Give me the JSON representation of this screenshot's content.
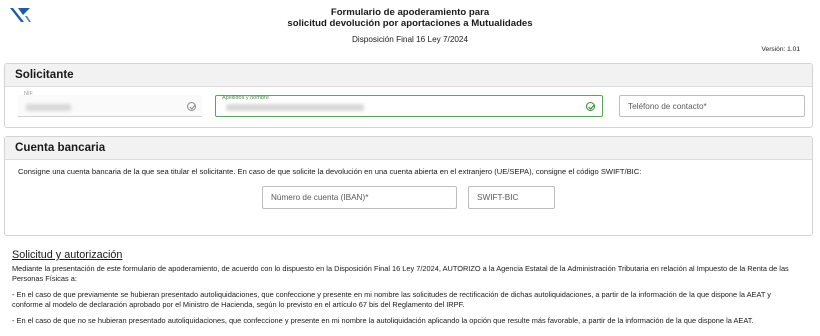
{
  "header": {
    "title_line1": "Formulario de apoderamiento para",
    "title_line2": "solicitud devolución por aportaciones a Mutualidades",
    "subtitle": "Disposición Final 16 Ley 7/2024",
    "version": "Versión: 1.01"
  },
  "solicitante": {
    "title": "Solicitante",
    "nif_label": "NIF",
    "apellidos_label": "Apellidos y nombre",
    "telefono_placeholder": "Teléfono de contacto*"
  },
  "cuenta": {
    "title": "Cuenta bancaria",
    "text": "Consigne una cuenta bancaria de la que sea titular el solicitante. En caso de que solicite la devolución en una cuenta abierta en el extranjero (UE/SEPA), consigne el código SWIFT/BIC:",
    "iban_placeholder": "Número de cuenta (IBAN)*",
    "swift_placeholder": "SWIFT-BIC"
  },
  "autorizacion": {
    "title": "Solicitud y autorización",
    "p1": "Mediante la presentación de este formulario de apoderamiento, de acuerdo con lo dispuesto en la Disposición Final 16 Ley 7/2024, AUTORIZO a la Agencia Estatal de la Administración Tributaria en relación al Impuesto de la Renta de las Personas Físicas a:",
    "p2": "- En el caso de que previamente se hubieran presentado autoliquidaciones, que confeccione y presente en mi nombre las solicitudes de rectificación de dichas autoliquidaciones, a partir de la información de la que dispone la AEAT y conforme al modelo de declaración aprobado por el Ministro de Hacienda, según lo previsto en el artículo 67 bis del Reglamento del IRPF.",
    "p3": "- En el caso de que no se hubieran presentado autoliquidaciones, que confeccione y presente en mi nombre la autoliquidación aplicando la opción que resulte más favorable, a partir de la información de la que dispone la AEAT."
  },
  "colors": {
    "valid_green": "#2e8b2e",
    "logo_blue": "#1d5ca8"
  }
}
